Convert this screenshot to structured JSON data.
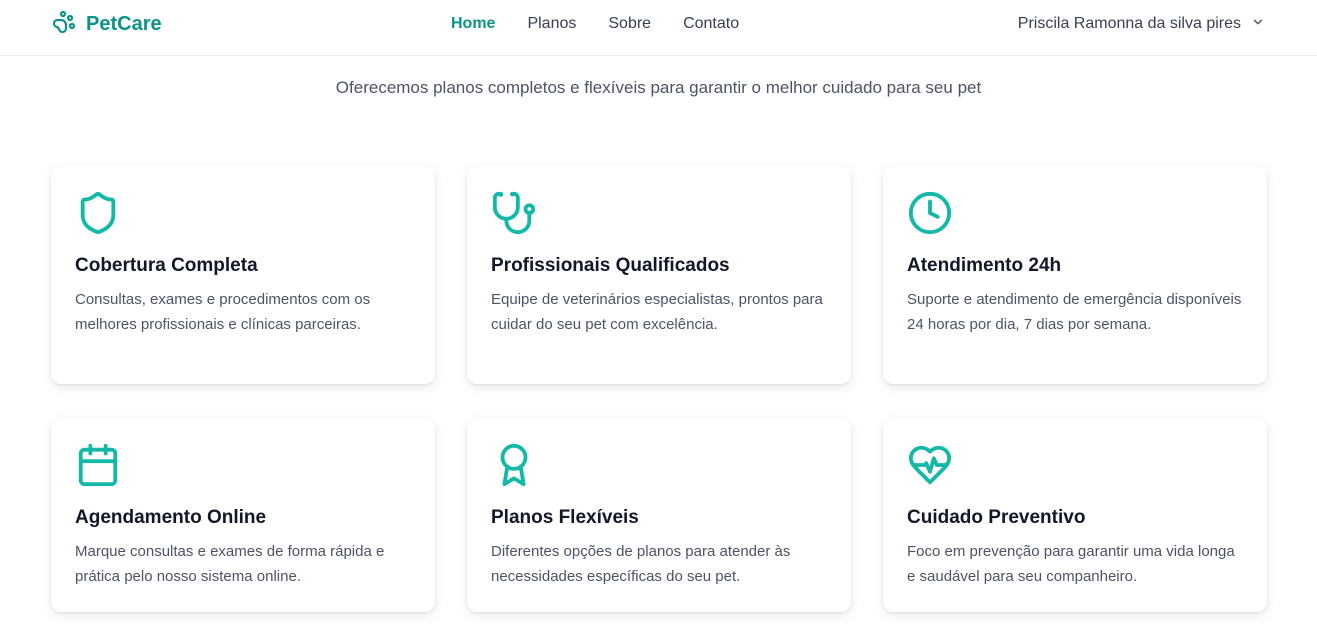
{
  "brand": {
    "name": "PetCare",
    "color": "#0d9488",
    "icon": "paw-icon"
  },
  "nav": {
    "items": [
      {
        "label": "Home",
        "active": true
      },
      {
        "label": "Planos",
        "active": false
      },
      {
        "label": "Sobre",
        "active": false
      },
      {
        "label": "Contato",
        "active": false
      }
    ]
  },
  "user": {
    "name": "Priscila Ramonna da silva pires",
    "icon": "chevron-down-icon"
  },
  "hero": {
    "subtitle": "Oferecemos planos completos e flexíveis para garantir o melhor cuidado para seu pet"
  },
  "features": [
    {
      "icon": "shield-icon",
      "title": "Cobertura Completa",
      "description": "Consultas, exames e procedimentos com os melhores profissionais e clínicas parceiras."
    },
    {
      "icon": "stethoscope-icon",
      "title": "Profissionais Qualificados",
      "description": "Equipe de veterinários especialistas, prontos para cuidar do seu pet com excelência."
    },
    {
      "icon": "clock-icon",
      "title": "Atendimento 24h",
      "description": "Suporte e atendimento de emergência disponíveis 24 horas por dia, 7 dias por semana."
    },
    {
      "icon": "calendar-icon",
      "title": "Agendamento Online",
      "description": "Marque consultas e exames de forma rápida e prática pelo nosso sistema online."
    },
    {
      "icon": "award-icon",
      "title": "Planos Flexíveis",
      "description": "Diferentes opções de planos para atender às necessidades específicas do seu pet."
    },
    {
      "icon": "heart-pulse-icon",
      "title": "Cuidado Preventivo",
      "description": "Foco em prevenção para garantir uma vida longa e saudável para seu companheiro."
    }
  ],
  "colors": {
    "accent": "#14b8a6",
    "text": "#111827",
    "muted": "#4b5563"
  }
}
